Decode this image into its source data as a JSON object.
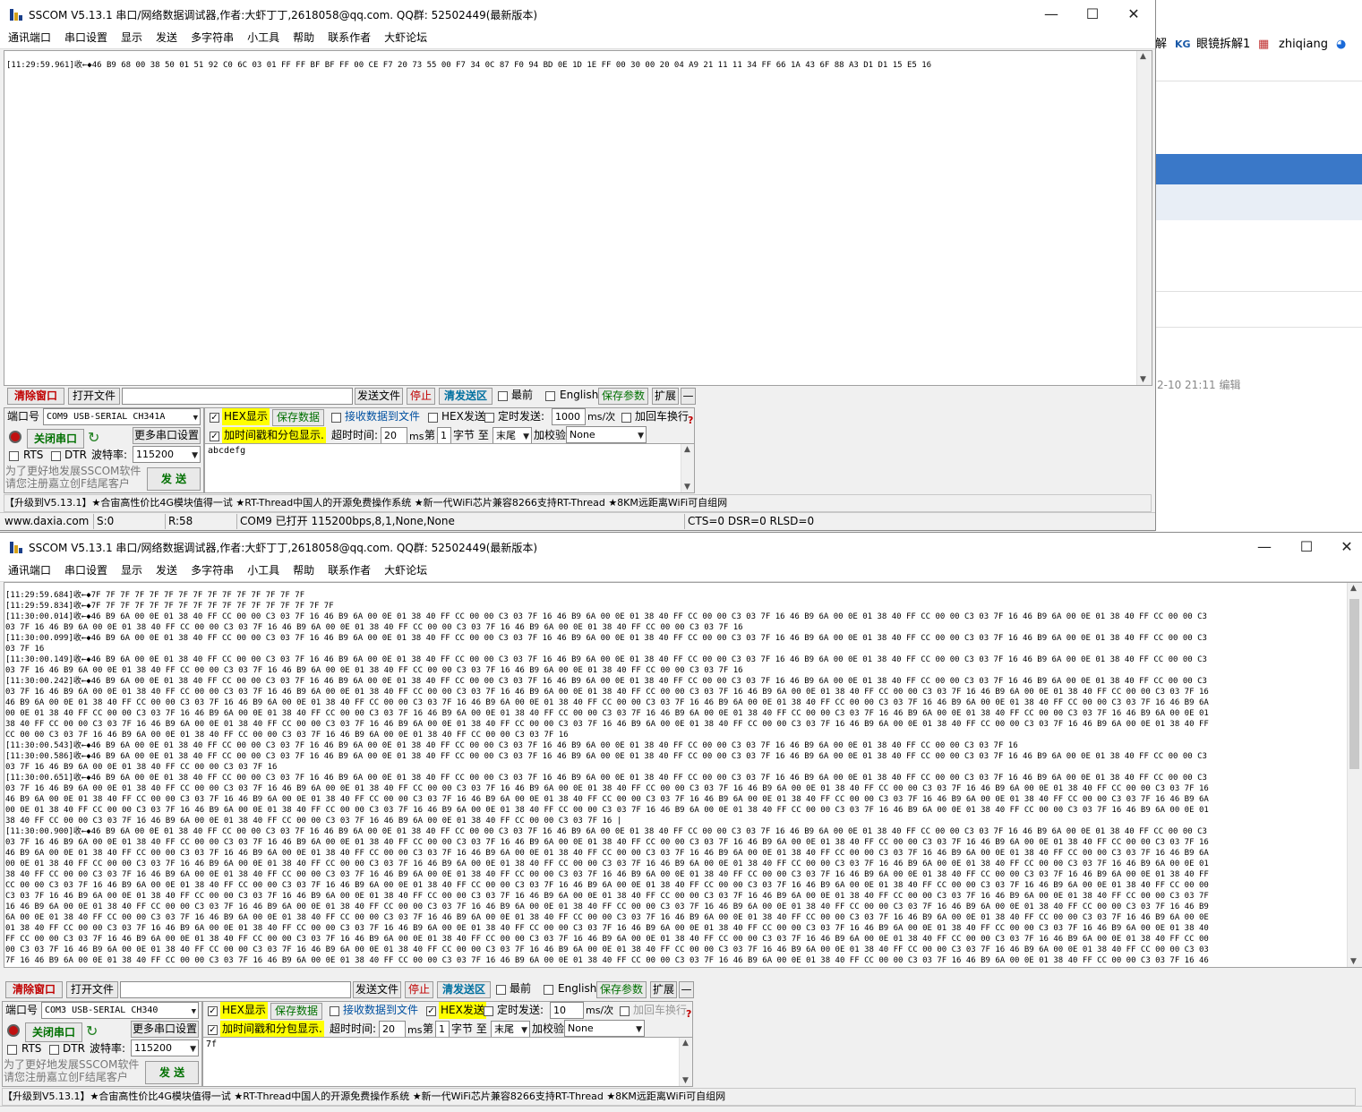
{
  "background": {
    "toolbar_items": [
      "解",
      "眼镜拆解1",
      "zhiqiang"
    ],
    "date_text": "2-10 21:11 编辑"
  },
  "menu": [
    "通讯端口",
    "串口设置",
    "显示",
    "发送",
    "多字符串",
    "小工具",
    "帮助",
    "联系作者",
    "大虾论坛"
  ],
  "win1": {
    "title": "SSCOM V5.13.1 串口/网络数据调试器,作者:大虾丁丁,2618058@qq.com. QQ群: 52502449(最新版本)",
    "recv_lines": [
      "[11:29:59.961]收←◆46 B9 68 00 38 50 01 51 92 C0 6C 03 01 FF FF BF BF FF 00 CE F7 20 73 55 00 F7 34 0C 87 F0 94 BD 0E 1D 1E FF 00 30 00 20 04 A9 21 11 11 34 FF 66 1A 43 6F 88 A3 D1 D1 15 E5 16"
    ],
    "clear_btn": "清除窗口",
    "open_file_btn": "打开文件",
    "send_file_btn": "发送文件",
    "stop_btn": "停止",
    "clear_send_btn": "清发送区",
    "last_chk": "最前",
    "english_chk": "English",
    "save_params_btn": "保存参数",
    "expand_btn": "扩展",
    "collapse_btn": "—",
    "port_label": "端口号",
    "port_value": "COM9 USB-SERIAL CH341A",
    "hex_display": "HEX显示",
    "save_data_btn": "保存数据",
    "recv_to_file": "接收数据到文件",
    "hex_send": "HEX发送",
    "timed_send": "定时发送:",
    "interval_value": "1000",
    "interval_unit": "ms/次",
    "add_crlf": "加回车换行",
    "help_mark": "?",
    "close_port_btn": "关闭串口",
    "more_settings_btn": "更多串口设置",
    "timestamp_chk": "加时间戳和分包显示.",
    "timeout_label": "超时时间:",
    "timeout_value": "20",
    "ms_label": "ms",
    "nth_label": "第",
    "nth_value": "1",
    "byte_label": "字节 至",
    "tail_value": "末尾",
    "checksum_label": "加校验",
    "checksum_value": "None",
    "rts": "RTS",
    "dtr": "DTR",
    "baud_label": "波特率:",
    "baud_value": "115200",
    "send_text": "abcdefg",
    "promo_line1": "为了更好地发展SSCOM软件",
    "promo_line2": "请您注册嘉立创F结尾客户",
    "send_btn": "发 送",
    "ticker": "【升级到V5.13.1】★合宙高性价比4G模块值得一试 ★RT-Thread中国人的开源免费操作系统 ★新一代WiFi芯片兼容8266支持RT-Thread ★8KM远距离WiFi可自组网",
    "status": {
      "site": "www.daxia.com",
      "sent": "S:0",
      "recv": "R:58",
      "port_info": "COM9 已打开  115200bps,8,1,None,None",
      "lines": "CTS=0 DSR=0 RLSD=0"
    }
  },
  "win2": {
    "title": "SSCOM V5.13.1 串口/网络数据调试器,作者:大虾丁丁,2618058@qq.com. QQ群: 52502449(最新版本)",
    "recv_lines": [
      "[11:29:59.684]收←◆7F 7F 7F 7F 7F 7F 7F 7F 7F 7F 7F 7F 7F 7F 7F",
      "[11:29:59.834]收←◆7F 7F 7F 7F 7F 7F 7F 7F 7F 7F 7F 7F 7F 7F 7F 7F 7F",
      "[11:30:00.014]收←◆46 B9 6A 00 0E 01 38 40 FF CC 00 00 C3 03 7F 16 46 B9 6A 00 0E 01 38 40 FF CC 00 00 C3 03 7F 16 46 B9 6A 00 0E 01 38 40 FF CC 00 00 C3 03 7F 16 46 B9 6A 00 0E 01 38 40 FF CC 00 00 C3 03 7F 16 46 B9 6A 00 0E 01 38 40 FF CC 00 00 C3",
      "03 7F 16 46 B9 6A 00 0E 01 38 40 FF CC 00 00 C3 03 7F 16 46 B9 6A 00 0E 01 38 40 FF CC 00 00 C3 03 7F 16 46 B9 6A 00 0E 01 38 40 FF CC 00 00 C3 03 7F 16",
      "[11:30:00.099]收←◆46 B9 6A 00 0E 01 38 40 FF CC 00 00 C3 03 7F 16 46 B9 6A 00 0E 01 38 40 FF CC 00 00 C3 03 7F 16 46 B9 6A 00 0E 01 38 40 FF CC 00 00 C3 03 7F 16 46 B9 6A 00 0E 01 38 40 FF CC 00 00 C3 03 7F 16 46 B9 6A 00 0E 01 38 40 FF CC 00 00 C3",
      "03 7F 16",
      "[11:30:00.149]收←◆46 B9 6A 00 0E 01 38 40 FF CC 00 00 C3 03 7F 16 46 B9 6A 00 0E 01 38 40 FF CC 00 00 C3 03 7F 16 46 B9 6A 00 0E 01 38 40 FF CC 00 00 C3 03 7F 16 46 B9 6A 00 0E 01 38 40 FF CC 00 00 C3 03 7F 16 46 B9 6A 00 0E 01 38 40 FF CC 00 00 C3",
      "03 7F 16 46 B9 6A 00 0E 01 38 40 FF CC 00 00 C3 03 7F 16 46 B9 6A 00 0E 01 38 40 FF CC 00 00 C3 03 7F 16 46 B9 6A 00 0E 01 38 40 FF CC 00 00 C3 03 7F 16",
      "[11:30:00.242]收←◆46 B9 6A 00 0E 01 38 40 FF CC 00 00 C3 03 7F 16 46 B9 6A 00 0E 01 38 40 FF CC 00 00 C3 03 7F 16 46 B9 6A 00 0E 01 38 40 FF CC 00 00 C3 03 7F 16 46 B9 6A 00 0E 01 38 40 FF CC 00 00 C3 03 7F 16 46 B9 6A 00 0E 01 38 40 FF CC 00 00 C3",
      "03 7F 16 46 B9 6A 00 0E 01 38 40 FF CC 00 00 C3 03 7F 16 46 B9 6A 00 0E 01 38 40 FF CC 00 00 C3 03 7F 16 46 B9 6A 00 0E 01 38 40 FF CC 00 00 C3 03 7F 16 46 B9 6A 00 0E 01 38 40 FF CC 00 00 C3 03 7F 16 46 B9 6A 00 0E 01 38 40 FF CC 00 00 C3 03 7F 16",
      "46 B9 6A 00 0E 01 38 40 FF CC 00 00 C3 03 7F 16 46 B9 6A 00 0E 01 38 40 FF CC 00 00 C3 03 7F 16 46 B9 6A 00 0E 01 38 40 FF CC 00 00 C3 03 7F 16 46 B9 6A 00 0E 01 38 40 FF CC 00 00 C3 03 7F 16 46 B9 6A 00 0E 01 38 40 FF CC 00 00 C3 03 7F 16 46 B9 6A",
      "00 0E 01 38 40 FF CC 00 00 C3 03 7F 16 46 B9 6A 00 0E 01 38 40 FF CC 00 00 C3 03 7F 16 46 B9 6A 00 0E 01 38 40 FF CC 00 00 C3 03 7F 16 46 B9 6A 00 0E 01 38 40 FF CC 00 00 C3 03 7F 16 46 B9 6A 00 0E 01 38 40 FF CC 00 00 C3 03 7F 16 46 B9 6A 00 0E 01",
      "38 40 FF CC 00 00 C3 03 7F 16 46 B9 6A 00 0E 01 38 40 FF CC 00 00 C3 03 7F 16 46 B9 6A 00 0E 01 38 40 FF CC 00 00 C3 03 7F 16 46 B9 6A 00 0E 01 38 40 FF CC 00 00 C3 03 7F 16 46 B9 6A 00 0E 01 38 40 FF CC 00 00 C3 03 7F 16 46 B9 6A 00 0E 01 38 40 FF",
      "CC 00 00 C3 03 7F 16 46 B9 6A 00 0E 01 38 40 FF CC 00 00 C3 03 7F 16 46 B9 6A 00 0E 01 38 40 FF CC 00 00 C3 03 7F 16",
      "[11:30:00.543]收←◆46 B9 6A 00 0E 01 38 40 FF CC 00 00 C3 03 7F 16 46 B9 6A 00 0E 01 38 40 FF CC 00 00 C3 03 7F 16 46 B9 6A 00 0E 01 38 40 FF CC 00 00 C3 03 7F 16 46 B9 6A 00 0E 01 38 40 FF CC 00 00 C3 03 7F 16",
      "[11:30:00.586]收←◆46 B9 6A 00 0E 01 38 40 FF CC 00 00 C3 03 7F 16 46 B9 6A 00 0E 01 38 40 FF CC 00 00 C3 03 7F 16 46 B9 6A 00 0E 01 38 40 FF CC 00 00 C3 03 7F 16 46 B9 6A 00 0E 01 38 40 FF CC 00 00 C3 03 7F 16 46 B9 6A 00 0E 01 38 40 FF CC 00 00 C3",
      "03 7F 16 46 B9 6A 00 0E 01 38 40 FF CC 00 00 C3 03 7F 16",
      "[11:30:00.651]收←◆46 B9 6A 00 0E 01 38 40 FF CC 00 00 C3 03 7F 16 46 B9 6A 00 0E 01 38 40 FF CC 00 00 C3 03 7F 16 46 B9 6A 00 0E 01 38 40 FF CC 00 00 C3 03 7F 16 46 B9 6A 00 0E 01 38 40 FF CC 00 00 C3 03 7F 16 46 B9 6A 00 0E 01 38 40 FF CC 00 00 C3",
      "03 7F 16 46 B9 6A 00 0E 01 38 40 FF CC 00 00 C3 03 7F 16 46 B9 6A 00 0E 01 38 40 FF CC 00 00 C3 03 7F 16 46 B9 6A 00 0E 01 38 40 FF CC 00 00 C3 03 7F 16 46 B9 6A 00 0E 01 38 40 FF CC 00 00 C3 03 7F 16 46 B9 6A 00 0E 01 38 40 FF CC 00 00 C3 03 7F 16",
      "46 B9 6A 00 0E 01 38 40 FF CC 00 00 C3 03 7F 16 46 B9 6A 00 0E 01 38 40 FF CC 00 00 C3 03 7F 16 46 B9 6A 00 0E 01 38 40 FF CC 00 00 C3 03 7F 16 46 B9 6A 00 0E 01 38 40 FF CC 00 00 C3 03 7F 16 46 B9 6A 00 0E 01 38 40 FF CC 00 00 C3 03 7F 16 46 B9 6A",
      "00 0E 01 38 40 FF CC 00 00 C3 03 7F 16 46 B9 6A 00 0E 01 38 40 FF CC 00 00 C3 03 7F 16 46 B9 6A 00 0E 01 38 40 FF CC 00 00 C3 03 7F 16 46 B9 6A 00 0E 01 38 40 FF CC 00 00 C3 03 7F 16 46 B9 6A 00 0E 01 38 40 FF CC 00 00 C3 03 7F 16 46 B9 6A 00 0E 01",
      "38 40 FF CC 00 00 C3 03 7F 16 46 B9 6A 00 0E 01 38 40 FF CC 00 00 C3 03 7F 16 46 B9 6A 00 0E 01 38 40 FF CC 00 00 C3 03 7F 16 |",
      "[11:30:00.900]收←◆46 B9 6A 00 0E 01 38 40 FF CC 00 00 C3 03 7F 16 46 B9 6A 00 0E 01 38 40 FF CC 00 00 C3 03 7F 16 46 B9 6A 00 0E 01 38 40 FF CC 00 00 C3 03 7F 16 46 B9 6A 00 0E 01 38 40 FF CC 00 00 C3 03 7F 16 46 B9 6A 00 0E 01 38 40 FF CC 00 00 C3",
      "03 7F 16 46 B9 6A 00 0E 01 38 40 FF CC 00 00 C3 03 7F 16 46 B9 6A 00 0E 01 38 40 FF CC 00 00 C3 03 7F 16 46 B9 6A 00 0E 01 38 40 FF CC 00 00 C3 03 7F 16 46 B9 6A 00 0E 01 38 40 FF CC 00 00 C3 03 7F 16 46 B9 6A 00 0E 01 38 40 FF CC 00 00 C3 03 7F 16",
      "46 B9 6A 00 0E 01 38 40 FF CC 00 00 C3 03 7F 16 46 B9 6A 00 0E 01 38 40 FF CC 00 00 C3 03 7F 16 46 B9 6A 00 0E 01 38 40 FF CC 00 00 C3 03 7F 16 46 B9 6A 00 0E 01 38 40 FF CC 00 00 C3 03 7F 16 46 B9 6A 00 0E 01 38 40 FF CC 00 00 C3 03 7F 16 46 B9 6A",
      "00 0E 01 38 40 FF CC 00 00 C3 03 7F 16 46 B9 6A 00 0E 01 38 40 FF CC 00 00 C3 03 7F 16 46 B9 6A 00 0E 01 38 40 FF CC 00 00 C3 03 7F 16 46 B9 6A 00 0E 01 38 40 FF CC 00 00 C3 03 7F 16 46 B9 6A 00 0E 01 38 40 FF CC 00 00 C3 03 7F 16 46 B9 6A 00 0E 01",
      "38 40 FF CC 00 00 C3 03 7F 16 46 B9 6A 00 0E 01 38 40 FF CC 00 00 C3 03 7F 16 46 B9 6A 00 0E 01 38 40 FF CC 00 00 C3 03 7F 16 46 B9 6A 00 0E 01 38 40 FF CC 00 00 C3 03 7F 16 46 B9 6A 00 0E 01 38 40 FF CC 00 00 C3 03 7F 16 46 B9 6A 00 0E 01 38 40 FF",
      "CC 00 00 C3 03 7F 16 46 B9 6A 00 0E 01 38 40 FF CC 00 00 C3 03 7F 16 46 B9 6A 00 0E 01 38 40 FF CC 00 00 C3 03 7F 16 46 B9 6A 00 0E 01 38 40 FF CC 00 00 C3 03 7F 16 46 B9 6A 00 0E 01 38 40 FF CC 00 00 C3 03 7F 16 46 B9 6A 00 0E 01 38 40 FF CC 00 00",
      "C3 03 7F 16 46 B9 6A 00 0E 01 38 40 FF CC 00 00 C3 03 7F 16 46 B9 6A 00 0E 01 38 40 FF CC 00 00 C3 03 7F 16 46 B9 6A 00 0E 01 38 40 FF CC 00 00 C3 03 7F 16 46 B9 6A 00 0E 01 38 40 FF CC 00 00 C3 03 7F 16 46 B9 6A 00 0E 01 38 40 FF CC 00 00 C3 03 7F",
      "16 46 B9 6A 00 0E 01 38 40 FF CC 00 00 C3 03 7F 16 46 B9 6A 00 0E 01 38 40 FF CC 00 00 C3 03 7F 16 46 B9 6A 00 0E 01 38 40 FF CC 00 00 C3 03 7F 16 46 B9 6A 00 0E 01 38 40 FF CC 00 00 C3 03 7F 16 46 B9 6A 00 0E 01 38 40 FF CC 00 00 C3 03 7F 16 46 B9",
      "6A 00 0E 01 38 40 FF CC 00 00 C3 03 7F 16 46 B9 6A 00 0E 01 38 40 FF CC 00 00 C3 03 7F 16 46 B9 6A 00 0E 01 38 40 FF CC 00 00 C3 03 7F 16 46 B9 6A 00 0E 01 38 40 FF CC 00 00 C3 03 7F 16 46 B9 6A 00 0E 01 38 40 FF CC 00 00 C3 03 7F 16 46 B9 6A 00 0E",
      "01 38 40 FF CC 00 00 C3 03 7F 16 46 B9 6A 00 0E 01 38 40 FF CC 00 00 C3 03 7F 16 46 B9 6A 00 0E 01 38 40 FF CC 00 00 C3 03 7F 16 46 B9 6A 00 0E 01 38 40 FF CC 00 00 C3 03 7F 16 46 B9 6A 00 0E 01 38 40 FF CC 00 00 C3 03 7F 16 46 B9 6A 00 0E 01 38 40",
      "FF CC 00 00 C3 03 7F 16 46 B9 6A 00 0E 01 38 40 FF CC 00 00 C3 03 7F 16 46 B9 6A 00 0E 01 38 40 FF CC 00 00 C3 03 7F 16 46 B9 6A 00 0E 01 38 40 FF CC 00 00 C3 03 7F 16 46 B9 6A 00 0E 01 38 40 FF CC 00 00 C3 03 7F 16 46 B9 6A 00 0E 01 38 40 FF CC 00",
      "00 C3 03 7F 16 46 B9 6A 00 0E 01 38 40 FF CC 00 00 C3 03 7F 16 46 B9 6A 00 0E 01 38 40 FF CC 00 00 C3 03 7F 16 46 B9 6A 00 0E 01 38 40 FF CC 00 00 C3 03 7F 16 46 B9 6A 00 0E 01 38 40 FF CC 00 00 C3 03 7F 16 46 B9 6A 00 0E 01 38 40 FF CC 00 00 C3 03",
      "7F 16 46 B9 6A 00 0E 01 38 40 FF CC 00 00 C3 03 7F 16 46 B9 6A 00 0E 01 38 40 FF CC 00 00 C3 03 7F 16 46 B9 6A 00 0E 01 38 40 FF CC 00 00 C3 03 7F 16 46 B9 6A 00 0E 01 38 40 FF CC 00 00 C3 03 7F 16 46 B9 6A 00 0E 01 38 40 FF CC 00 00 C3 03 7F 16 46"
    ],
    "clear_btn": "清除窗口",
    "open_file_btn": "打开文件",
    "send_file_btn": "发送文件",
    "stop_btn": "停止",
    "clear_send_btn": "清发送区",
    "last_chk": "最前",
    "english_chk": "English",
    "save_params_btn": "保存参数",
    "expand_btn": "扩展",
    "collapse_btn": "—",
    "port_label": "端口号",
    "port_value": "COM3 USB-SERIAL CH340",
    "hex_display": "HEX显示",
    "save_data_btn": "保存数据",
    "recv_to_file": "接收数据到文件",
    "hex_send": "HEX发送",
    "timed_send": "定时发送:",
    "interval_value": "10",
    "interval_unit": "ms/次",
    "add_crlf": "加回车换行",
    "help_mark": "?",
    "close_port_btn": "关闭串口",
    "more_settings_btn": "更多串口设置",
    "timestamp_chk": "加时间戳和分包显示.",
    "timeout_label": "超时时间:",
    "timeout_value": "20",
    "ms_label": "ms",
    "nth_label": "第",
    "nth_value": "1",
    "byte_label": "字节 至",
    "tail_value": "末尾",
    "checksum_label": "加校验",
    "checksum_value": "None",
    "rts": "RTS",
    "dtr": "DTR",
    "baud_label": "波特率:",
    "baud_value": "115200",
    "send_text": "7f",
    "promo_line1": "为了更好地发展SSCOM软件",
    "promo_line2": "请您注册嘉立创F结尾客户",
    "send_btn": "发 送",
    "ticker": "【升级到V5.13.1】★合宙高性价比4G模块值得一试 ★RT-Thread中国人的开源免费操作系统 ★新一代WiFi芯片兼容8266支持RT-Thread ★8KM远距离WiFi可自组网"
  }
}
